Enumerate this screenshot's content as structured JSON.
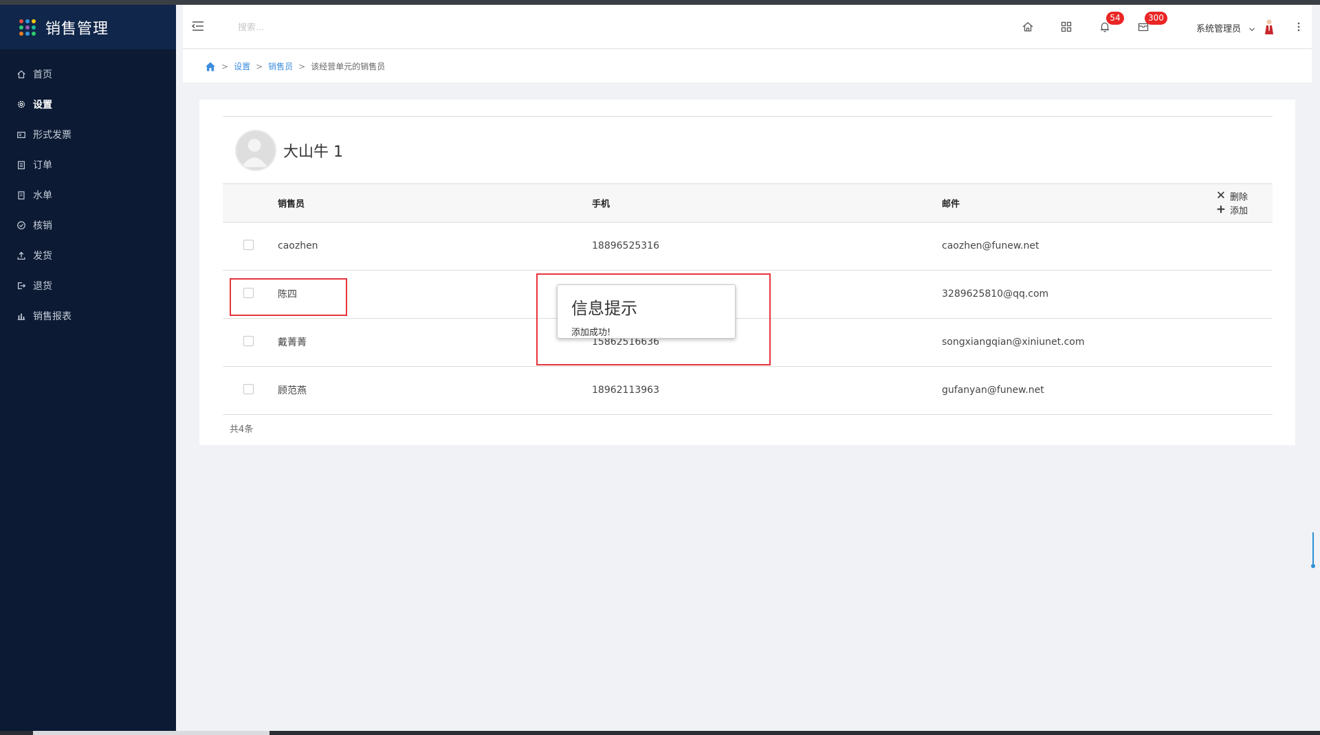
{
  "app": {
    "title": "销售管理",
    "logo_dot_colors": [
      "#e74c3c",
      "#3498db",
      "#f1c40f",
      "#2ecc71",
      "#9b59b6",
      "#1abc9c",
      "#e67e22",
      "#3498db",
      "#2ecc71"
    ]
  },
  "sidebar": {
    "items": [
      {
        "label": "首页",
        "icon": "home-icon",
        "active": false
      },
      {
        "label": "设置",
        "icon": "gear-icon",
        "active": true
      },
      {
        "label": "形式发票",
        "icon": "invoice-icon",
        "active": false
      },
      {
        "label": "订单",
        "icon": "clipboard-icon",
        "active": false
      },
      {
        "label": "水单",
        "icon": "receipt-icon",
        "active": false
      },
      {
        "label": "核销",
        "icon": "check-circle-icon",
        "active": false
      },
      {
        "label": "发货",
        "icon": "upload-icon",
        "active": false
      },
      {
        "label": "退货",
        "icon": "logout-icon",
        "active": false
      },
      {
        "label": "销售报表",
        "icon": "bar-chart-icon",
        "active": false
      }
    ]
  },
  "header": {
    "search_placeholder": "搜索...",
    "notifications_count": "54",
    "messages_count": "300",
    "user_name": "系统管理员"
  },
  "breadcrumb": {
    "items": [
      "设置",
      "销售员"
    ],
    "current": "该经营单元的销售员",
    "separator": ">"
  },
  "profile": {
    "name": "大山牛 1"
  },
  "table": {
    "headers": {
      "name": "销售员",
      "phone": "手机",
      "email": "邮件"
    },
    "actions": {
      "delete": "删除",
      "add": "添加"
    },
    "rows": [
      {
        "name": "caozhen",
        "phone": "18896525316",
        "email": "caozhen@funew.net"
      },
      {
        "name": "陈四",
        "phone": "",
        "email": "3289625810@qq.com"
      },
      {
        "name": "戴菁菁",
        "phone": "15862516636",
        "email": "songxiangqian@xiniunet.com"
      },
      {
        "name": "顾范燕",
        "phone": "18962113963",
        "email": "gufanyan@funew.net"
      }
    ],
    "total": "共4条"
  },
  "dialog": {
    "title": "信息提示",
    "message": "添加成功!"
  },
  "colors": {
    "sidebar_bg": "#0c1a33",
    "accent": "#3c8dde",
    "badge": "#ea2525",
    "highlight": "#e8333b"
  }
}
